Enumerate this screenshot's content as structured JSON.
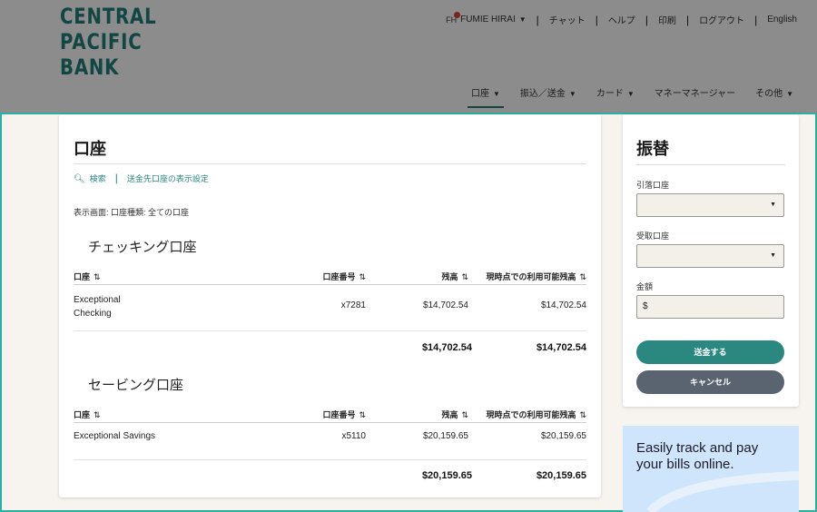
{
  "logo": {
    "line1": "CENTRAL",
    "line2": "PACIFIC",
    "line3": "BANK"
  },
  "topnav": {
    "avatar_initials": "FH",
    "user_name": "FUMIE HIRAI",
    "chat": "チャット",
    "help": "ヘルプ",
    "print": "印刷",
    "logout": "ログアウト",
    "language": "English"
  },
  "mainnav": {
    "items": [
      "口座",
      "振込／送金",
      "カード",
      "マネーマネージャー",
      "その他"
    ]
  },
  "accounts": {
    "title": "口座",
    "search_link": "検索",
    "display_settings_link": "送金先口座の表示設定",
    "filter_text": "表示画面: 口座種類: 全ての口座",
    "columns": {
      "account": "口座",
      "account_number": "口座番号",
      "balance": "残高",
      "available": "現時点での利用可能残高"
    },
    "checking": {
      "title": "チェッキング口座",
      "rows": [
        {
          "name_line1": "Exceptional",
          "name_line2": "Checking",
          "number": "x7281",
          "balance": "$14,702.54",
          "available": "$14,702.54"
        }
      ],
      "total_balance": "$14,702.54",
      "total_available": "$14,702.54"
    },
    "savings": {
      "title": "セービング口座",
      "rows": [
        {
          "name": "Exceptional Savings",
          "number": "x5110",
          "balance": "$20,159.65",
          "available": "$20,159.65"
        }
      ],
      "total_balance": "$20,159.65",
      "total_available": "$20,159.65"
    }
  },
  "transfer": {
    "title": "振替",
    "from_label": "引落口座",
    "from_value": "",
    "to_label": "受取口座",
    "to_value": "",
    "amount_label": "金額",
    "amount_prefix": "$",
    "send_button": "送金する",
    "cancel_button": "キャンセル"
  },
  "promo": {
    "line1": "Easily track and pay",
    "line2": "your bills online."
  },
  "colors": {
    "brand_teal": "#1f8078",
    "frame_accent": "#2ab0a0",
    "send_button": "#2b8880",
    "cancel_button": "#5a6470",
    "promo_bg": "#cfe5fb"
  }
}
